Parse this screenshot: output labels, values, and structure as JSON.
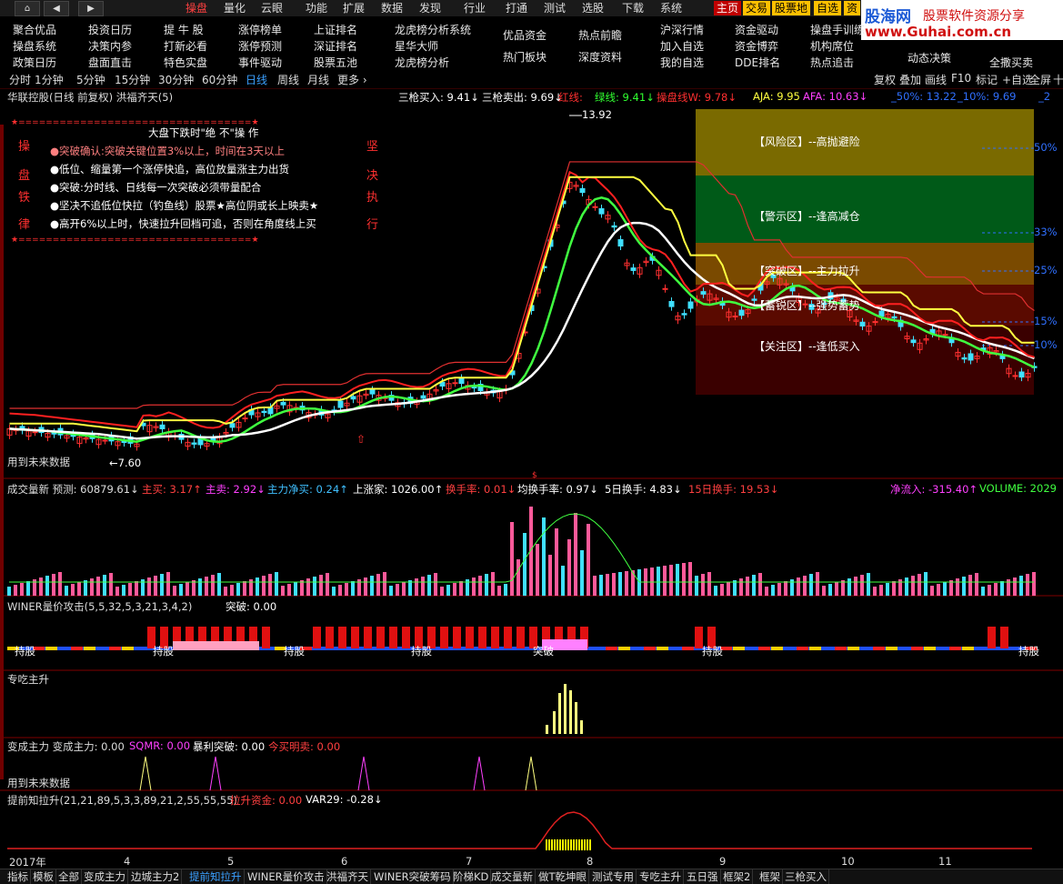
{
  "nav": {
    "home_icon": "home-icon",
    "menus": [
      "操盘",
      "量化",
      "云眼",
      "功能",
      "扩展",
      "数据",
      "发现",
      "行业",
      "打通",
      "测试",
      "选股",
      "下载",
      "系统"
    ],
    "active_menu": "操盘",
    "tags": [
      {
        "label": "主页",
        "color": "#ffffff",
        "bg": "#c00000"
      },
      {
        "label": "交易",
        "color": "#000000",
        "bg": "#ffc000"
      },
      {
        "label": "股票地",
        "color": "#000000",
        "bg": "#ffc000"
      },
      {
        "label": "自选",
        "color": "#000000",
        "bg": "#ffc000"
      },
      {
        "label": "资",
        "color": "#000000",
        "bg": "#ffc000"
      }
    ]
  },
  "logo": {
    "brand": "股海网",
    "slogan": "股票软件资源分享",
    "url": "www.Guhai.com.cn"
  },
  "quickmenu": {
    "items": [
      [
        "聚合优品",
        "投资日历",
        "提 牛 股",
        "涨停榜单",
        "上证排名",
        "龙虎榜分析系统",
        "优品资金",
        "热点前瞻",
        "沪深行情",
        "资金驱动",
        "操盘手训练"
      ],
      [
        "操盘系统",
        "决策内参",
        "打新必看",
        "涨停预测",
        "深证排名",
        "星华大师",
        "热门板块",
        "深度资料",
        "加入自选",
        "资金博弈",
        "机构席位"
      ],
      [
        "政策日历",
        "盘面直击",
        "特色实盘",
        "事件驱动",
        "股票五池",
        "龙虎榜分析",
        "",
        "",
        "我的自选",
        "DDE排名",
        "热点追击",
        "动态决策",
        "全撒买卖"
      ]
    ]
  },
  "periods": [
    "分时",
    "1分钟",
    "5分钟",
    "15分钟",
    "30分钟",
    "60分钟",
    "日线",
    "周线",
    "月线",
    "更多"
  ],
  "period_selected": "日线",
  "right_tools": [
    "复权",
    "叠加",
    "画线",
    "F10",
    "标记",
    "+自选",
    "全屏",
    "十"
  ],
  "main": {
    "stock_title": "华联控股(日线 前复权) 洪福齐天(5)",
    "indicators": [
      {
        "text": "三枪买入: 9.41↓",
        "color": "#ffffff"
      },
      {
        "text": "三枪卖出: 9.69↓",
        "color": "#ffffff"
      },
      {
        "text": "红线: ",
        "color": "#ff3030"
      },
      {
        "text": "绿线: 9.41↓",
        "color": "#30ff30"
      },
      {
        "text": "操盘线W: 9.78↓",
        "color": "#ff3030"
      },
      {
        "text": "AJA: 9.95",
        "color": "#ffff40"
      },
      {
        "text": "AFA: 10.63↓",
        "color": "#ff40ff"
      },
      {
        "text": "_50%: 13.22",
        "color": "#3070ff"
      },
      {
        "text": "_10%: 9.69",
        "color": "#3070ff"
      },
      {
        "text": "_2",
        "color": "#3070ff"
      }
    ],
    "high_label": "13.92",
    "low_label": "7.60",
    "future_label": "用到未来数据",
    "rules_title": "大盘下跌时\"绝 不\"操 作",
    "rules": [
      "●突破确认:突破关键位置3%以上，时间在3天以上",
      "●低位、缩量第一个涨停快追，高位放量涨主力出货",
      "●突破:分时线、日线每一次突破必须带量配合",
      "●坚决不追低位快拉（钓鱼线）股票★高位阴或长上映卖★",
      "●高开6%以上时，快速拉升回档可追，否则在角度线上买"
    ],
    "left_side": [
      "操",
      "盘",
      "铁",
      "律"
    ],
    "right_side": [
      "坚",
      "决",
      "执",
      "行"
    ],
    "zones": [
      {
        "label": "【风险区】--高抛避险",
        "color": "#7a6a00"
      },
      {
        "label": "【警示区】--逢高减仓",
        "color": "#005a18"
      },
      {
        "label": "【突破区】--主力拉升",
        "color": "#7a4a00"
      },
      {
        "label": "【蓄锐区】--强势蓄势",
        "color": "#5a0a00"
      },
      {
        "label": "【关注区】--逢低买入",
        "color": "#3a0000"
      }
    ],
    "pct_labels": [
      "50%",
      "33%",
      "25%",
      "15%",
      "10%"
    ]
  },
  "volume_panel": {
    "items": [
      {
        "text": "成交量新 预测: 60879.61↓",
        "color": "#dddddd"
      },
      {
        "text": "主买: 3.17↑",
        "color": "#ff4040"
      },
      {
        "text": "主卖: 2.92↓",
        "color": "#ff40ff"
      },
      {
        "text": "主力净买: 0.24↑",
        "color": "#40c0ff"
      },
      {
        "text": "上涨家: 1026.00↑",
        "color": "#ffffff"
      },
      {
        "text": "换手率: 0.01↓",
        "color": "#ff4040"
      },
      {
        "text": "均换手率: 0.97↓",
        "color": "#ffffff"
      },
      {
        "text": "5日换手: 4.83↓",
        "color": "#ffffff"
      },
      {
        "text": "15日换手: 19.53↓",
        "color": "#ff4040"
      },
      {
        "text": "净流入: -315.40↑",
        "color": "#ff40ff"
      },
      {
        "text": "VOLUME: 2029",
        "color": "#40ff40"
      }
    ]
  },
  "winer_panel": {
    "title": "WINER量价攻击(5,5,32,5,3,21,3,4,2)",
    "sub": "突破: 0.00",
    "hold_labels": [
      "持股",
      "持股",
      "持股",
      "持股",
      "突破",
      "持股",
      "持股"
    ]
  },
  "zc_panel": {
    "title": "专吃主升"
  },
  "bc_panel": {
    "items": [
      {
        "text": "变成主力  变成主力: 0.00",
        "color": "#dddddd"
      },
      {
        "text": "SQMR: 0.00",
        "color": "#ff40ff"
      },
      {
        "text": "暴利突破: 0.00",
        "color": "#ffffff"
      },
      {
        "text": "今买明卖: 0.00",
        "color": "#ff4040"
      }
    ],
    "future_label": "用到未来数据"
  },
  "tq_panel": {
    "items": [
      {
        "text": "提前知拉升(21,21,89,5,3,3,89,21,2,55,55,55)",
        "color": "#dddddd"
      },
      {
        "text": "拉升资金: 0.00",
        "color": "#ff4040"
      },
      {
        "text": "VAR29: -0.28↓",
        "color": "#ffffff"
      }
    ]
  },
  "dates": [
    "2017年",
    "4",
    "5",
    "6",
    "7",
    "8",
    "9",
    "10",
    "11"
  ],
  "tabs": [
    "指标",
    "模板",
    "全部",
    "变成主力",
    "边城主力2",
    "提前知拉升",
    "WINER量价攻击",
    "洪福齐天",
    "WINER突破筹码",
    "阶梯KD",
    "成交量新",
    "做T乾坤眼",
    "测试专用",
    "专吃主升",
    "五日强",
    "框架2",
    "框架",
    "三枪买入"
  ],
  "tab_selected": "提前知拉升"
}
